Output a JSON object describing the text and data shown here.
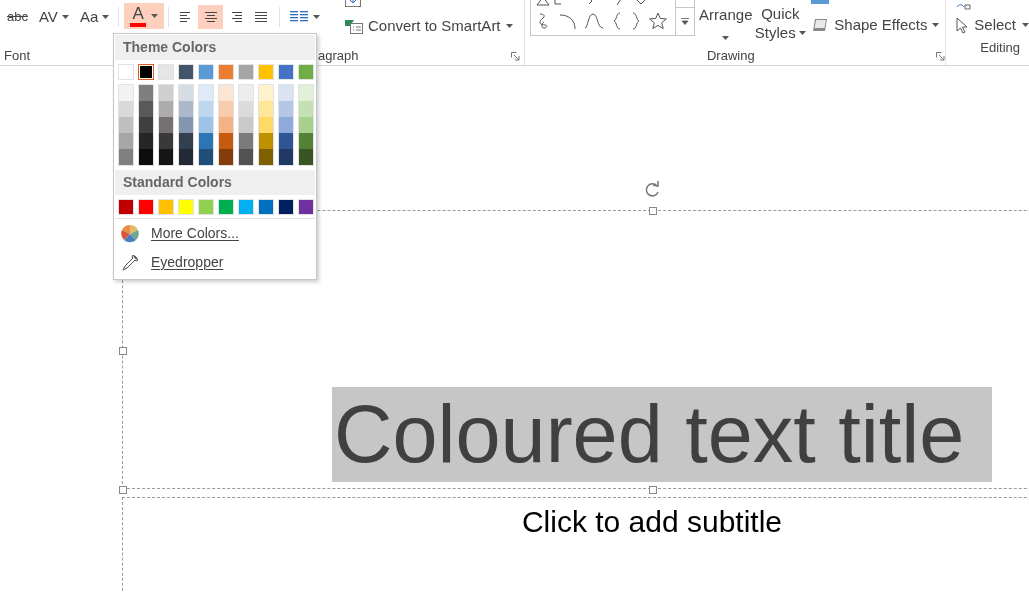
{
  "ribbon": {
    "font_buttons": [
      {
        "kind": "strikethrough",
        "label": "abc"
      },
      {
        "kind": "spacing",
        "label": "AV"
      },
      {
        "kind": "case",
        "label": "Aa"
      }
    ],
    "font_color": {
      "label": "A",
      "color": "#ff0000",
      "selected": true
    },
    "align_buttons": [
      {
        "kind": "left",
        "selected": false
      },
      {
        "kind": "center",
        "selected": true
      },
      {
        "kind": "right",
        "selected": false
      },
      {
        "kind": "justify",
        "selected": false
      }
    ],
    "convert_smartart": "Convert to SmartArt",
    "arrange": "Arrange",
    "quick_styles": [
      "Quick",
      "Styles"
    ],
    "shape_effects": "Shape Effects",
    "select": "Select",
    "group_labels": {
      "font": "Font",
      "paragraph": "agraph",
      "drawing": "Drawing",
      "editing": "Editing"
    }
  },
  "color_menu": {
    "theme_title": "Theme Colors",
    "theme_colors": [
      {
        "color": "#ffffff",
        "selected": false,
        "shades": [
          {
            "color": "#f2f2f2"
          },
          {
            "color": "#d9d9d9"
          },
          {
            "color": "#bfbfbf"
          },
          {
            "color": "#a6a6a6"
          },
          {
            "color": "#808080"
          }
        ]
      },
      {
        "color": "#000000",
        "selected": true,
        "shades": [
          {
            "color": "#7f7f7f"
          },
          {
            "color": "#595959"
          },
          {
            "color": "#3f3f3f"
          },
          {
            "color": "#262626"
          },
          {
            "color": "#0d0d0d"
          }
        ]
      },
      {
        "color": "#e7e6e6",
        "selected": false,
        "shades": [
          {
            "color": "#d0cece"
          },
          {
            "color": "#aeabab"
          },
          {
            "color": "#757171"
          },
          {
            "color": "#3a3838"
          },
          {
            "color": "#171616"
          }
        ]
      },
      {
        "color": "#44546a",
        "selected": false,
        "shades": [
          {
            "color": "#d6dce4"
          },
          {
            "color": "#adb9ca"
          },
          {
            "color": "#8496b0"
          },
          {
            "color": "#323f4f"
          },
          {
            "color": "#222a35"
          }
        ]
      },
      {
        "color": "#5b9bd5",
        "selected": false,
        "shades": [
          {
            "color": "#deebf6"
          },
          {
            "color": "#bdd7ee"
          },
          {
            "color": "#9dc3e6"
          },
          {
            "color": "#2e75b5"
          },
          {
            "color": "#1f4e79"
          }
        ]
      },
      {
        "color": "#ed7d31",
        "selected": false,
        "shades": [
          {
            "color": "#fbe5d5"
          },
          {
            "color": "#f8cbad"
          },
          {
            "color": "#f4b183"
          },
          {
            "color": "#c55a11"
          },
          {
            "color": "#843c0b"
          }
        ]
      },
      {
        "color": "#a5a5a5",
        "selected": false,
        "shades": [
          {
            "color": "#ededed"
          },
          {
            "color": "#dbdbdb"
          },
          {
            "color": "#c9c9c9"
          },
          {
            "color": "#7b7b7b"
          },
          {
            "color": "#525252"
          }
        ]
      },
      {
        "color": "#ffc000",
        "selected": false,
        "shades": [
          {
            "color": "#fff2cc"
          },
          {
            "color": "#ffe699"
          },
          {
            "color": "#ffd966"
          },
          {
            "color": "#bf9000"
          },
          {
            "color": "#7f6000"
          }
        ]
      },
      {
        "color": "#4472c4",
        "selected": false,
        "shades": [
          {
            "color": "#dae3f3"
          },
          {
            "color": "#b4c7e7"
          },
          {
            "color": "#8faadc"
          },
          {
            "color": "#2f5597"
          },
          {
            "color": "#203864"
          }
        ]
      },
      {
        "color": "#70ad47",
        "selected": false,
        "shades": [
          {
            "color": "#e2efd9"
          },
          {
            "color": "#c5e0b3"
          },
          {
            "color": "#a8d08d"
          },
          {
            "color": "#538135"
          },
          {
            "color": "#375623"
          }
        ]
      }
    ],
    "standard_title": "Standard Colors",
    "standard_colors": [
      {
        "color": "#c00000"
      },
      {
        "color": "#ff0000"
      },
      {
        "color": "#ffc000"
      },
      {
        "color": "#ffff00"
      },
      {
        "color": "#92d050"
      },
      {
        "color": "#00b050"
      },
      {
        "color": "#00b0f0"
      },
      {
        "color": "#0070c0"
      },
      {
        "color": "#002060"
      },
      {
        "color": "#7030a0"
      }
    ],
    "items": [
      {
        "kind": "more",
        "label": "More Colors..."
      },
      {
        "kind": "eyedropper",
        "label": "Eyedropper"
      }
    ]
  },
  "slide": {
    "title": "Coloured text title",
    "title_highlighted": true,
    "subtitle_placeholder": "Click to add subtitle"
  }
}
